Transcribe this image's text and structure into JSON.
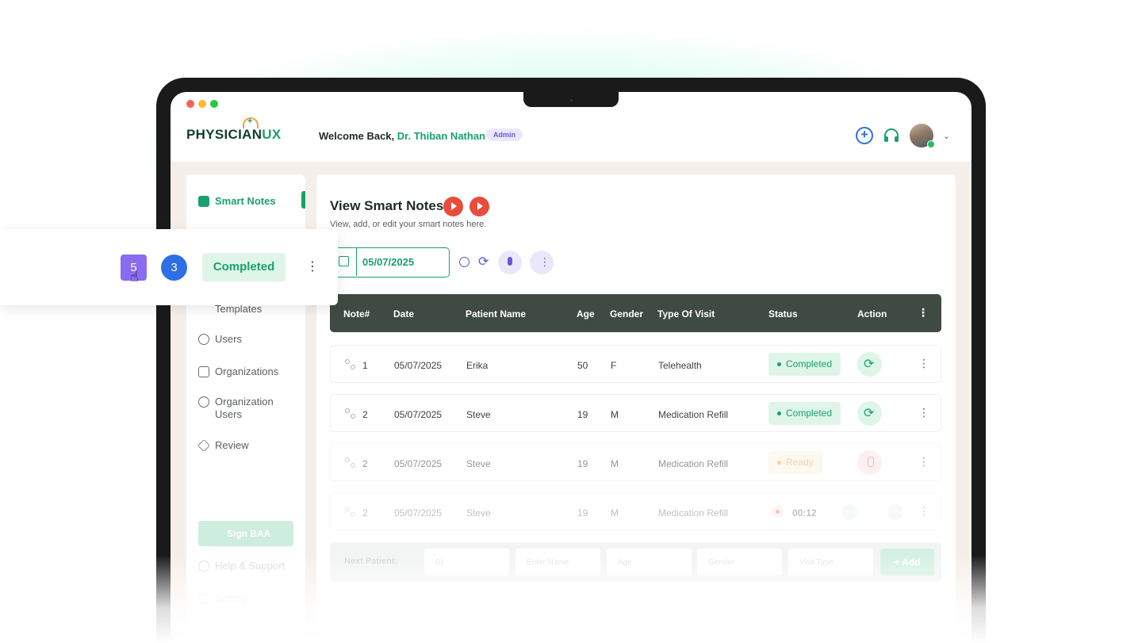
{
  "brand": {
    "logo_main": "PHYSICIAN",
    "logo_accent": "UX"
  },
  "header": {
    "welcome_prefix": "Welcome Back,",
    "doctor_name": "Dr. Thiban Nathan",
    "role_badge": "Admin",
    "icons": [
      "add-icon",
      "headset-icon",
      "avatar",
      "chevron-down-icon"
    ]
  },
  "sidebar": {
    "items": [
      {
        "label": "Smart Notes",
        "icon": "clipboard-icon",
        "active": true
      },
      {
        "label": "Templates",
        "icon": "grid-icon"
      },
      {
        "label": "Users",
        "icon": "user-circle-icon"
      },
      {
        "label": "Organizations",
        "icon": "layout-icon"
      },
      {
        "label": "Organization Users",
        "icon": "users-group-icon"
      },
      {
        "label": "Review",
        "icon": "star-icon"
      }
    ],
    "sign_baa": "Sign BAA",
    "help": "Help & Support",
    "setting": "Setting"
  },
  "main": {
    "title": "View Smart Notes",
    "subtitle": "View, add, or edit your smart notes here.",
    "date_value": "05/07/2025",
    "columns": [
      "Note#",
      "Date",
      "Patient Name",
      "Age",
      "Gender",
      "Type Of Visit",
      "Status",
      "Action"
    ],
    "rows": [
      {
        "note": "1",
        "date": "05/07/2025",
        "patient": "Erika",
        "age": "50",
        "gender": "F",
        "visit": "Telehealth",
        "status": "Completed",
        "action": "sync-icon"
      },
      {
        "note": "2",
        "date": "05/07/2025",
        "patient": "Steve",
        "age": "19",
        "gender": "M",
        "visit": "Medication Refill",
        "status": "Completed",
        "action": "sync-icon"
      },
      {
        "note": "2",
        "date": "05/07/2025",
        "patient": "Steve",
        "age": "19",
        "gender": "M",
        "visit": "Medication Refill",
        "status": "Ready",
        "action": "mic-icon"
      },
      {
        "note": "2",
        "date": "05/07/2025",
        "patient": "Steve",
        "age": "19",
        "gender": "M",
        "visit": "Medication Refill",
        "status": "00:12",
        "action": "recording-controls"
      }
    ],
    "next_patient": {
      "label": "Next Patient:",
      "placeholders": [
        "01",
        "Enter Name",
        "Age",
        "Gender",
        "Visit Type"
      ],
      "add": "+ Add"
    }
  },
  "popup": {
    "square_value": "5",
    "circle_value": "3",
    "status": "Completed"
  },
  "colors": {
    "accent": "#1aa06b",
    "dark_header": "#3f4a43",
    "purple": "#6a58d6",
    "red": "#e74c3c"
  }
}
